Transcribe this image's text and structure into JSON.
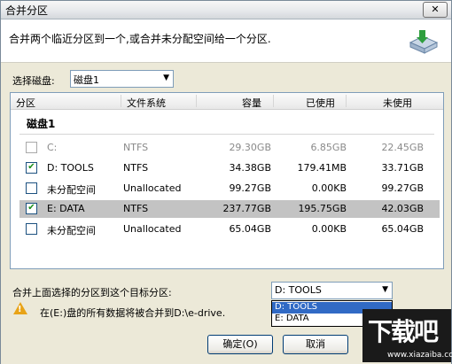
{
  "window": {
    "title": "合并分区",
    "close_label": "✕"
  },
  "header": {
    "description": "合并两个临近分区到一个,或合并未分配空间给一个分区."
  },
  "disk_select": {
    "label": "选择磁盘:",
    "value": "磁盘1"
  },
  "table": {
    "columns": [
      "分区",
      "文件系统",
      "容量",
      "已使用",
      "未使用"
    ],
    "group": "磁盘1",
    "rows": [
      {
        "name": "C:",
        "fs": "NTFS",
        "capacity": "29.30GB",
        "used": "6.85GB",
        "free": "22.45GB",
        "checked": false,
        "enabled": false,
        "selected": false
      },
      {
        "name": "D:  TOOLS",
        "fs": "NTFS",
        "capacity": "34.38GB",
        "used": "179.41MB",
        "free": "33.71GB",
        "checked": true,
        "enabled": true,
        "selected": false
      },
      {
        "name": "未分配空间",
        "fs": "Unallocated",
        "capacity": "99.27GB",
        "used": "0.00KB",
        "free": "99.27GB",
        "checked": false,
        "enabled": true,
        "selected": false
      },
      {
        "name": "E:  DATA",
        "fs": "NTFS",
        "capacity": "237.77GB",
        "used": "195.75GB",
        "free": "42.03GB",
        "checked": true,
        "enabled": true,
        "selected": true
      },
      {
        "name": "未分配空间",
        "fs": "Unallocated",
        "capacity": "65.04GB",
        "used": "0.00KB",
        "free": "65.04GB",
        "checked": false,
        "enabled": true,
        "selected": false
      }
    ]
  },
  "target": {
    "label": "合并上面选择的分区到这个目标分区:",
    "value": "D:  TOOLS",
    "options": [
      "D:  TOOLS",
      "E:  DATA"
    ],
    "highlighted_index": 0
  },
  "warning": {
    "text": "在(E:)盘的所有数据将被合并到D:\\e-drive."
  },
  "buttons": {
    "ok": "确定(O)",
    "cancel": "取消"
  },
  "watermark": {
    "text": "下载吧",
    "url": "www.xiazaiba.com"
  }
}
